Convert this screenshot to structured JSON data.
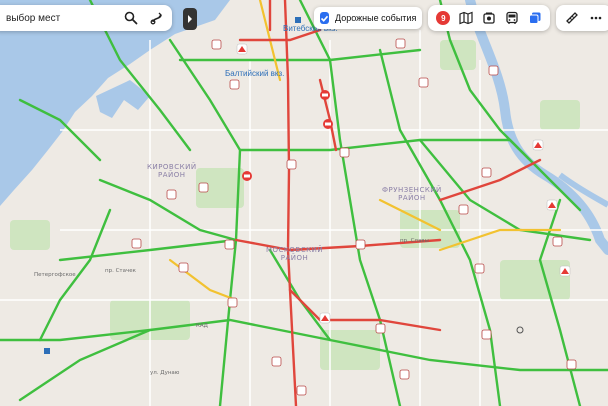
{
  "search": {
    "placeholder": "выбор мест"
  },
  "traffic_toggle": {
    "label": "Дорожные события",
    "checked": true
  },
  "traffic_score": {
    "value": "9",
    "color": "#e53935"
  },
  "layers": [
    "map-icon",
    "camera-icon",
    "bus-icon",
    "layers-icon"
  ],
  "tools": [
    "ruler-icon",
    "more-icon"
  ],
  "map": {
    "districts": [
      {
        "text": "КИРОВСКИЙ\nРАЙОН"
      },
      {
        "text": "ФРУНЗЕНСКИЙ\nРАЙОН"
      },
      {
        "text": "МОСКОВСКИЙ\nРАЙОН"
      }
    ],
    "stations": [
      "Витебский вкз.",
      "Балтийский вкз."
    ],
    "roads": [
      "пр. Стачек",
      "КАД",
      "Петергофское",
      "ул. Дунаю",
      "пр. Славы"
    ],
    "colors": {
      "water": "#a9c8e8",
      "land": "#eeeae4",
      "park": "#cfe5c0",
      "traffic_free": "#3fbf3f",
      "traffic_moderate": "#f2c230",
      "traffic_jam": "#e0463c",
      "incident_marker": "#e53935"
    }
  }
}
